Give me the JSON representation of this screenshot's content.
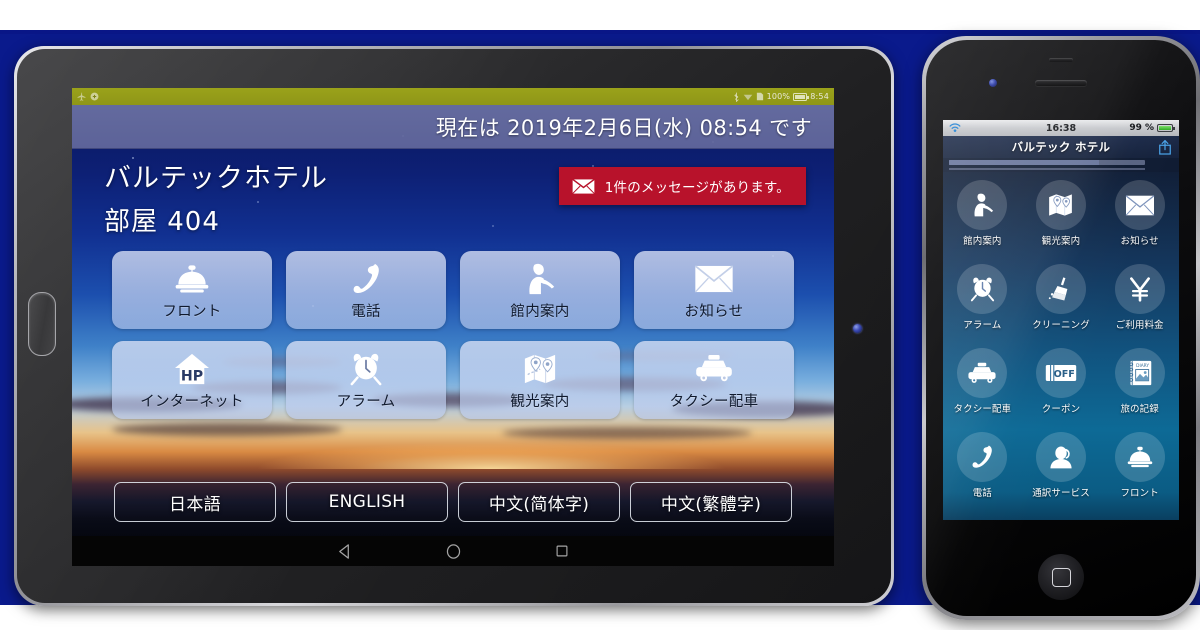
{
  "tablet": {
    "system_status": {
      "icons": [
        "bluetooth-icon",
        "wifi-icon",
        "sd-card-icon"
      ],
      "battery_percent": "100%",
      "time": "8:54"
    },
    "date_bar": {
      "text": "現在は 2019年2月6日(水) 08:54 です"
    },
    "hotel_name": "バルテックホテル",
    "room": "部屋 404",
    "message_banner": {
      "icon": "envelope-icon",
      "text": "1件のメッセージがあります。",
      "color": "#b8122b"
    },
    "tiles": [
      {
        "label": "フロント",
        "icon": "service-bell-icon"
      },
      {
        "label": "電話",
        "icon": "phone-handset-icon"
      },
      {
        "label": "館内案内",
        "icon": "concierge-person-icon"
      },
      {
        "label": "お知らせ",
        "icon": "envelope-icon"
      },
      {
        "label": "インターネット",
        "icon": "house-hp-icon"
      },
      {
        "label": "アラーム",
        "icon": "alarm-clock-icon"
      },
      {
        "label": "観光案内",
        "icon": "map-pin-icon"
      },
      {
        "label": "タクシー配車",
        "icon": "taxi-icon"
      }
    ],
    "languages": [
      {
        "label": "日本語"
      },
      {
        "label": "ENGLISH"
      },
      {
        "label": "中文(简体字)"
      },
      {
        "label": "中文(繁體字)"
      }
    ],
    "nav_bar": [
      "back-icon",
      "home-icon",
      "recents-icon"
    ]
  },
  "phone": {
    "system_status": {
      "wifi": "wifi-icon",
      "time": "16:38",
      "battery_percent": "99 %"
    },
    "title": "バルテック ホテル",
    "share_icon": "share-icon",
    "tiles": [
      {
        "label": "館内案内",
        "icon": "concierge-person-icon"
      },
      {
        "label": "観光案内",
        "icon": "map-pin-icon"
      },
      {
        "label": "お知らせ",
        "icon": "envelope-icon"
      },
      {
        "label": "アラーム",
        "icon": "alarm-clock-icon"
      },
      {
        "label": "クリーニング",
        "icon": "broom-icon"
      },
      {
        "label": "ご利用料金",
        "icon": "yen-icon"
      },
      {
        "label": "タクシー配車",
        "icon": "taxi-icon"
      },
      {
        "label": "クーポン",
        "icon": "coupon-off-icon"
      },
      {
        "label": "旅の記録",
        "icon": "diary-book-icon"
      },
      {
        "label": "電話",
        "icon": "phone-handset-icon"
      },
      {
        "label": "通訳サービス",
        "icon": "interpreter-headset-icon"
      },
      {
        "label": "フロント",
        "icon": "service-bell-icon"
      }
    ],
    "home_button": "home-button"
  }
}
